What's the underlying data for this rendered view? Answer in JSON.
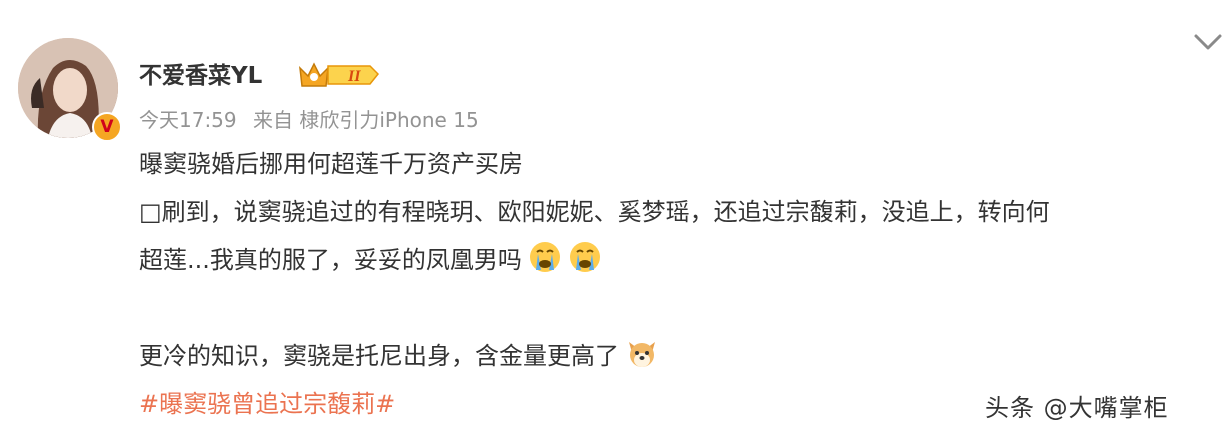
{
  "post": {
    "username": "不爱香菜YL",
    "time": "今天17:59",
    "source": "来自 棣欣引力iPhone 15",
    "verified_label": "V",
    "lines": [
      "曝窦骁婚后挪用何超莲千万资产买房",
      "□刷到，说窦骁追过的有程晓玥、欧阳妮妮、奚梦瑶，还追过宗馥莉，没追上，转向何",
      "超莲...我真的服了，妥妥的凤凰男吗",
      "更冷的知识，窦骁是托尼出身，含金量更高了"
    ],
    "hashtag": "#曝窦骁曾追过宗馥莉#",
    "badge_level": "II"
  },
  "icons": {
    "avatar": "avatar-image",
    "verified": "verified-badge-icon",
    "crown": "crown-badge-icon",
    "menu": "chevron-down-icon",
    "emoji_cry": "crying-emoji-icon",
    "emoji_dog": "dog-emoji-icon"
  },
  "watermark": "头条 @大嘴掌柜",
  "colors": {
    "hashtag": "#eb7350",
    "meta": "#939393",
    "badge": "#f5a623"
  }
}
